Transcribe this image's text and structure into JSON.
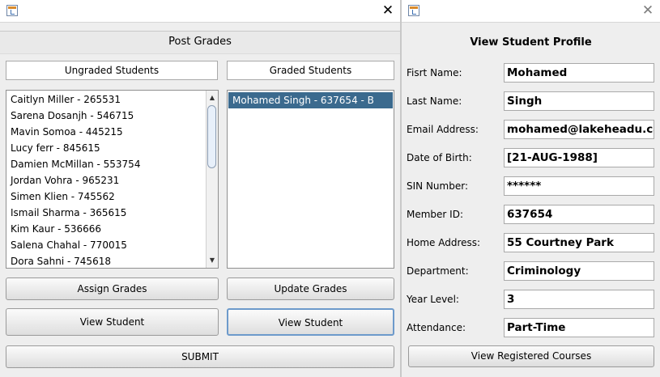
{
  "left_window": {
    "header": "Post Grades",
    "ungraded_label": "Ungraded Students",
    "graded_label": "Graded Students",
    "ungraded_students": [
      "Caitlyn Miller - 265531",
      "Sarena Dosanjh - 546715",
      "Mavin Somoa - 445215",
      "Lucy ferr - 845615",
      "Damien McMillan - 553754",
      "Jordan Vohra - 965231",
      "Simen Klien - 745562",
      "Ismail Sharma - 365615",
      "Kim Kaur - 536666",
      "Salena Chahal - 770015",
      "Dora Sahni - 745618"
    ],
    "graded_students": [
      "Mohamed Singh - 637654 - B"
    ],
    "buttons": {
      "assign": "Assign Grades",
      "update": "Update Grades",
      "view_left": "View Student",
      "view_right": "View Student",
      "submit": "SUBMIT"
    },
    "close_glyph": "✕"
  },
  "right_window": {
    "header": "View Student Profile",
    "fields": [
      {
        "label": "Fisrt Name:",
        "value": "Mohamed"
      },
      {
        "label": "Last Name:",
        "value": "Singh"
      },
      {
        "label": "Email Address:",
        "value": "mohamed@lakeheadu.ca"
      },
      {
        "label": "Date of Birth:",
        "value": "[21-AUG-1988]"
      },
      {
        "label": "SIN Number:",
        "value": "******"
      },
      {
        "label": "Member ID:",
        "value": "637654"
      },
      {
        "label": "Home Address:",
        "value": "55 Courtney Park"
      },
      {
        "label": "Department:",
        "value": "Criminology"
      },
      {
        "label": "Year Level:",
        "value": "3"
      },
      {
        "label": "Attendance:",
        "value": "Part-Time"
      }
    ],
    "button": "View Registered Courses",
    "close_glyph": "✕"
  },
  "colors": {
    "selection": "#3b6a8e",
    "focus_border": "#6d9acb"
  }
}
